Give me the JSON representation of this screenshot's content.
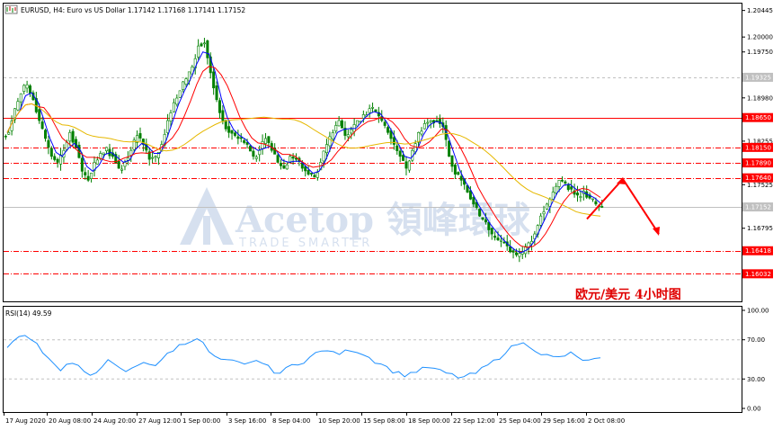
{
  "header": {
    "symbol_line": "EURUSD, H4:  Euro vs US Dollar  1.17142 1.17168 1.17141 1.17152"
  },
  "rsi_header": "RSI(14) 49.59",
  "caption": "欧元/美元   4小时图",
  "watermark": {
    "brand": "Acetop 領峰環球",
    "tagline": "TRADE SMARTER"
  },
  "colors": {
    "bull": "#008000",
    "bear": "#008000",
    "ma_fast": "#0000ff",
    "ma_mid": "#ff0000",
    "ma_slow": "#e6b800",
    "level": "#ff0000",
    "rsi": "#1e90ff",
    "arrow": "#ff0000",
    "price_tag": "#ff0000",
    "current_tag": "#c0c0c0"
  },
  "chart_data": [
    {
      "type": "candlestick",
      "title": "EURUSD, H4",
      "ylim": [
        1.156,
        1.2053
      ],
      "y_ticks": [
        "1.20445",
        "1.20000",
        "1.19750",
        "1.19325",
        "1.18980",
        "1.18650",
        "1.18255",
        "1.18150",
        "1.17890",
        "1.17640",
        "1.17525",
        "1.17152",
        "1.16795",
        "1.16418",
        "1.16032"
      ],
      "x_labels": [
        "17 Aug 2020",
        "20 Aug 08:00",
        "24 Aug 20:00",
        "27 Aug 12:00",
        "1 Sep 00:00",
        "3 Sep 16:00",
        "8 Sep 04:00",
        "10 Sep 20:00",
        "15 Sep 08:00",
        "18 Sep 00:00",
        "22 Sep 12:00",
        "25 Sep 04:00",
        "29 Sep 16:00",
        "2 Oct 08:00"
      ],
      "horizontal_levels": [
        {
          "value": 1.1865,
          "style": "solid",
          "label": "1.18650"
        },
        {
          "value": 1.1815,
          "style": "dashdot",
          "label": "1.18150"
        },
        {
          "value": 1.1789,
          "style": "dashdot",
          "label": "1.17890"
        },
        {
          "value": 1.1764,
          "style": "dashdot",
          "label": "1.17640"
        },
        {
          "value": 1.16418,
          "style": "dashdot",
          "label": "1.16418"
        },
        {
          "value": 1.16032,
          "style": "dashdot",
          "label": "1.16032"
        }
      ],
      "current_price": {
        "value": 1.17152,
        "label": "1.17152"
      },
      "marked_level": {
        "value": 1.19325,
        "label": "1.19325"
      },
      "close_path": [
        1.184,
        1.188,
        1.1905,
        1.192,
        1.1895,
        1.186,
        1.183,
        1.18,
        1.179,
        1.181,
        1.184,
        1.1815,
        1.1775,
        1.176,
        1.179,
        1.1805,
        1.1815,
        1.18,
        1.178,
        1.179,
        1.181,
        1.1835,
        1.182,
        1.1795,
        1.18,
        1.182,
        1.186,
        1.189,
        1.191,
        1.193,
        1.195,
        1.1985,
        1.199,
        1.194,
        1.1895,
        1.186,
        1.184,
        1.1835,
        1.183,
        1.182,
        1.18,
        1.181,
        1.183,
        1.181,
        1.179,
        1.178,
        1.18,
        1.1795,
        1.178,
        1.177,
        1.1765,
        1.179,
        1.182,
        1.184,
        1.186,
        1.1835,
        1.1845,
        1.186,
        1.187,
        1.188,
        1.1875,
        1.186,
        1.184,
        1.182,
        1.18,
        1.178,
        1.181,
        1.184,
        1.1855,
        1.186,
        1.186,
        1.185,
        1.18,
        1.177,
        1.176,
        1.174,
        1.172,
        1.17,
        1.169,
        1.167,
        1.166,
        1.1655,
        1.164,
        1.1635,
        1.164,
        1.1655,
        1.167,
        1.17,
        1.172,
        1.174,
        1.176,
        1.1755,
        1.1745,
        1.1735,
        1.1742,
        1.173,
        1.172,
        1.1715
      ],
      "projection": [
        1.1695,
        1.1762,
        1.167
      ],
      "series": [
        {
          "name": "MA fast",
          "color": "#0000ff"
        },
        {
          "name": "MA mid",
          "color": "#ff0000"
        },
        {
          "name": "MA slow",
          "color": "#e6b800"
        }
      ]
    },
    {
      "type": "line",
      "title": "RSI(14) 49.59",
      "ylim": [
        0,
        100
      ],
      "y_ticks": [
        "100.00",
        "70.00",
        "30.00",
        "0.00"
      ],
      "levels": [
        70,
        30
      ],
      "values": [
        62,
        68,
        72,
        74,
        72,
        66,
        58,
        52,
        44,
        40,
        44,
        46,
        42,
        36,
        34,
        38,
        44,
        48,
        44,
        40,
        38,
        40,
        44,
        48,
        46,
        44,
        48,
        56,
        60,
        64,
        66,
        70,
        72,
        66,
        58,
        52,
        50,
        48,
        48,
        46,
        44,
        46,
        50,
        46,
        42,
        38,
        36,
        40,
        44,
        46,
        48,
        52,
        56,
        58,
        60,
        56,
        56,
        58,
        60,
        58,
        56,
        52,
        48,
        46,
        42,
        38,
        36,
        34,
        36,
        38,
        40,
        42,
        40,
        38,
        36,
        34,
        32,
        32,
        34,
        36,
        40,
        44,
        48,
        52,
        58,
        62,
        66,
        66,
        64,
        60,
        56,
        54,
        52,
        52,
        54,
        56,
        52,
        50,
        48,
        50,
        50
      ]
    }
  ]
}
